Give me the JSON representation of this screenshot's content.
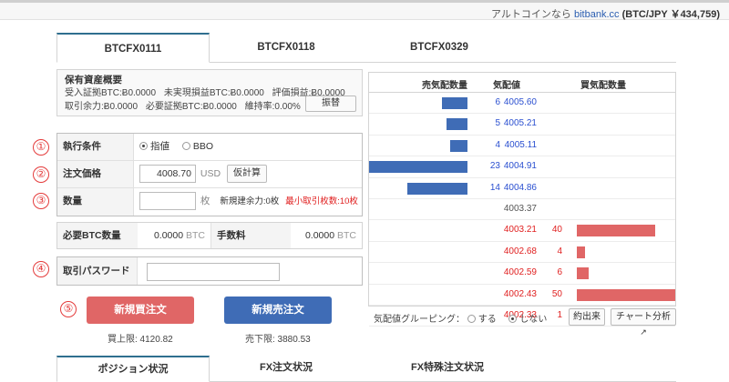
{
  "topbar": {
    "prefix": "アルトコインなら",
    "link": "bitbank.cc",
    "price": "(BTC/JPY ￥434,759)"
  },
  "tabs": [
    {
      "label": "BTCFX0111"
    },
    {
      "label": "BTCFX0118"
    },
    {
      "label": "BTCFX0329"
    }
  ],
  "assets": {
    "title": "保有資産概要",
    "row1": [
      "受入証拠BTC:Ƀ0.0000",
      "未実現損益BTC:Ƀ0.0000",
      "評価損益:Ƀ0.0000"
    ],
    "row2": [
      "取引余力:Ƀ0.0000",
      "必要証拠BTC:Ƀ0.0000",
      "維持率:0.00%"
    ],
    "swap_label": "振替"
  },
  "markers": [
    "①",
    "②",
    "③",
    "④",
    "⑤"
  ],
  "form": {
    "exec_label": "執行条件",
    "exec_options": [
      "指値",
      "BBO"
    ],
    "price_label": "注文価格",
    "price_value": "4008.70",
    "price_unit": "USD",
    "calc_label": "仮計算",
    "qty_label": "数量",
    "qty_value": "",
    "qty_unit": "枚",
    "capacity": "新規建余力:0枚",
    "min_qty": "最小取引枚数:10枚"
  },
  "btc": {
    "required_label": "必要BTC数量",
    "required_value": "0.0000",
    "unit": "BTC",
    "fee_label": "手数料",
    "fee_value": "0.0000"
  },
  "password": {
    "label": "取引パスワード",
    "value": ""
  },
  "actions": {
    "buy_label": "新規買注文",
    "sell_label": "新規売注文",
    "buy_limit": "買上限: 4120.82",
    "sell_limit": "売下限: 3880.53"
  },
  "colors": {
    "buy": "#e06666",
    "sell": "#3f6cb6",
    "bid_bar": "#e06666",
    "ask_bar": "#3f6cb6"
  },
  "orderbook": {
    "headers": [
      "売気配数量",
      "気配値",
      "買気配数量"
    ],
    "asks": [
      {
        "qty": "6",
        "price": "4005.60",
        "level": 6
      },
      {
        "qty": "5",
        "price": "4005.21",
        "level": 5
      },
      {
        "qty": "4",
        "price": "4005.11",
        "level": 4
      },
      {
        "qty": "23",
        "price": "4004.91",
        "level": 23
      },
      {
        "qty": "14",
        "price": "4004.86",
        "level": 14
      }
    ],
    "mid": "4003.37",
    "bids": [
      {
        "price": "4003.21",
        "qty": "40",
        "level": 40
      },
      {
        "price": "4002.68",
        "qty": "4",
        "level": 4
      },
      {
        "price": "4002.59",
        "qty": "6",
        "level": 6
      },
      {
        "price": "4002.43",
        "qty": "50",
        "level": 50
      },
      {
        "price": "4002.33",
        "qty": "1",
        "level": 1
      }
    ],
    "grouping_label": "気配値グルーピング：",
    "grouping_options": [
      "する",
      "しない"
    ],
    "trades_label": "約出来",
    "chart_label": "チャート分析"
  },
  "bottom_tabs": [
    {
      "label": "ポジション状況"
    },
    {
      "label": "FX注文状況"
    },
    {
      "label": "FX特殊注文状況"
    }
  ]
}
